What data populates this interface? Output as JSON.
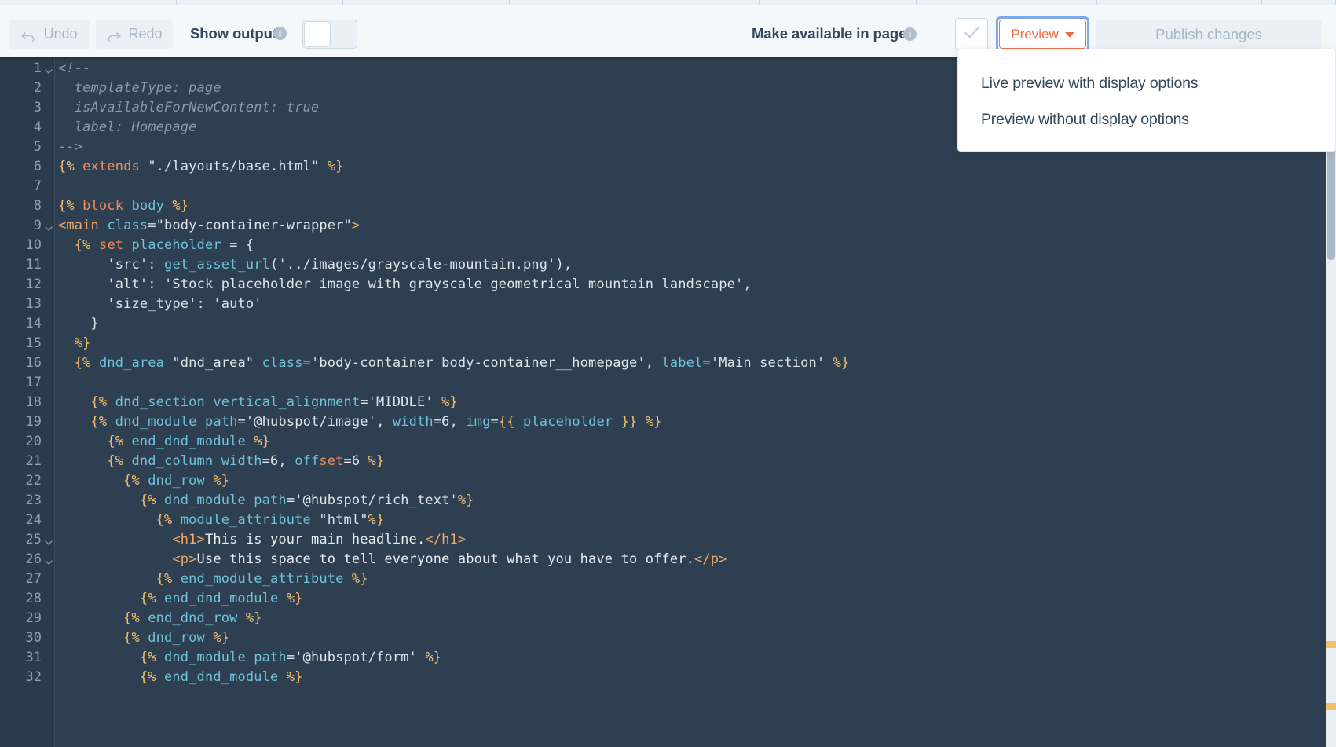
{
  "toolbar": {
    "undo_label": "Undo",
    "redo_label": "Redo",
    "show_output_label": "Show output",
    "show_output_toggle_state": "off",
    "make_available_label": "Make available in pages",
    "check_icon": "checkmark-icon",
    "preview_label": "Preview",
    "publish_label": "Publish changes",
    "info_glyph": "i"
  },
  "preview_menu": {
    "items": [
      {
        "label": "Live preview with display options"
      },
      {
        "label": "Preview without display options"
      }
    ]
  },
  "colors": {
    "editor_background": "#2e3f51",
    "gutter_background": "#2b3b4c",
    "toolbar_background": "#f5f8fa",
    "accent_orange": "#ef6c43",
    "focus_blue": "#7fa8e8",
    "delimiter_yellow": "#f4c06d",
    "keyword_orange": "#f08d5c",
    "function_teal": "#6fc3d9",
    "comment_gray": "#8c9aa8",
    "marker_yellow": "#f4c06d",
    "scrollbar_thumb": "#aab9c9"
  },
  "editor": {
    "language": "HubL / HTML",
    "first_visible_line": 1,
    "last_visible_line": 32,
    "fold_markers": [
      1,
      9,
      25,
      26
    ],
    "scrollbar_markers": [
      816,
      895
    ],
    "lines": [
      {
        "n": 1,
        "tokens": [
          {
            "t": "comment",
            "v": "<!--"
          }
        ]
      },
      {
        "n": 2,
        "tokens": [
          {
            "t": "comment",
            "v": "  templateType: page"
          }
        ]
      },
      {
        "n": 3,
        "tokens": [
          {
            "t": "comment",
            "v": "  isAvailableForNewContent: true"
          }
        ]
      },
      {
        "n": 4,
        "tokens": [
          {
            "t": "comment",
            "v": "  label: Homepage"
          }
        ]
      },
      {
        "n": 5,
        "tokens": [
          {
            "t": "comment",
            "v": "-->"
          }
        ]
      },
      {
        "n": 6,
        "tokens": [
          {
            "t": "delim",
            "v": "{% "
          },
          {
            "t": "kw",
            "v": "extends"
          },
          {
            "t": "str",
            "v": " \"./layouts/base.html\" "
          },
          {
            "t": "delim",
            "v": "%}"
          }
        ]
      },
      {
        "n": 7,
        "tokens": []
      },
      {
        "n": 8,
        "tokens": [
          {
            "t": "delim",
            "v": "{% "
          },
          {
            "t": "kw",
            "v": "block"
          },
          {
            "t": "fn",
            "v": " body "
          },
          {
            "t": "delim",
            "v": "%}"
          }
        ]
      },
      {
        "n": 9,
        "tokens": [
          {
            "t": "tag",
            "v": "<main"
          },
          {
            "t": "attr",
            "v": " class"
          },
          {
            "t": "punc",
            "v": "="
          },
          {
            "t": "str",
            "v": "\"body-container-wrapper\""
          },
          {
            "t": "tag",
            "v": ">"
          }
        ]
      },
      {
        "n": 10,
        "tokens": [
          {
            "t": "txt",
            "v": "  "
          },
          {
            "t": "delim",
            "v": "{% "
          },
          {
            "t": "kw",
            "v": "set"
          },
          {
            "t": "fn",
            "v": " placeholder "
          },
          {
            "t": "punc",
            "v": "= {"
          }
        ]
      },
      {
        "n": 11,
        "tokens": [
          {
            "t": "txt",
            "v": "      "
          },
          {
            "t": "str",
            "v": "'src'"
          },
          {
            "t": "punc",
            "v": ": "
          },
          {
            "t": "fn",
            "v": "get_asset_url"
          },
          {
            "t": "punc",
            "v": "("
          },
          {
            "t": "str",
            "v": "'../images/grayscale-mountain.png'"
          },
          {
            "t": "punc",
            "v": "),"
          }
        ]
      },
      {
        "n": 12,
        "tokens": [
          {
            "t": "txt",
            "v": "      "
          },
          {
            "t": "str",
            "v": "'alt'"
          },
          {
            "t": "punc",
            "v": ": "
          },
          {
            "t": "str",
            "v": "'Stock placeholder image with grayscale geometrical mountain landscape'"
          },
          {
            "t": "punc",
            "v": ","
          }
        ]
      },
      {
        "n": 13,
        "tokens": [
          {
            "t": "txt",
            "v": "      "
          },
          {
            "t": "str",
            "v": "'size_type'"
          },
          {
            "t": "punc",
            "v": ": "
          },
          {
            "t": "str",
            "v": "'auto'"
          }
        ]
      },
      {
        "n": 14,
        "tokens": [
          {
            "t": "txt",
            "v": "    "
          },
          {
            "t": "punc",
            "v": "}"
          }
        ]
      },
      {
        "n": 15,
        "tokens": [
          {
            "t": "txt",
            "v": "  "
          },
          {
            "t": "delim",
            "v": "%}"
          }
        ]
      },
      {
        "n": 16,
        "tokens": [
          {
            "t": "txt",
            "v": "  "
          },
          {
            "t": "delim",
            "v": "{% "
          },
          {
            "t": "fn",
            "v": "dnd_area"
          },
          {
            "t": "str",
            "v": " \"dnd_area\""
          },
          {
            "t": "attr",
            "v": " class"
          },
          {
            "t": "punc",
            "v": "="
          },
          {
            "t": "str",
            "v": "'body-container body-container__homepage'"
          },
          {
            "t": "punc",
            "v": ", "
          },
          {
            "t": "attr",
            "v": "label"
          },
          {
            "t": "punc",
            "v": "="
          },
          {
            "t": "str",
            "v": "'Main section' "
          },
          {
            "t": "delim",
            "v": "%}"
          }
        ]
      },
      {
        "n": 17,
        "tokens": []
      },
      {
        "n": 18,
        "tokens": [
          {
            "t": "txt",
            "v": "    "
          },
          {
            "t": "delim",
            "v": "{% "
          },
          {
            "t": "fn",
            "v": "dnd_section"
          },
          {
            "t": "attr",
            "v": " vertical_alignment"
          },
          {
            "t": "punc",
            "v": "="
          },
          {
            "t": "str",
            "v": "'MIDDLE' "
          },
          {
            "t": "delim",
            "v": "%}"
          }
        ]
      },
      {
        "n": 19,
        "tokens": [
          {
            "t": "txt",
            "v": "    "
          },
          {
            "t": "delim",
            "v": "{% "
          },
          {
            "t": "fn",
            "v": "dnd_module"
          },
          {
            "t": "attr",
            "v": " path"
          },
          {
            "t": "punc",
            "v": "="
          },
          {
            "t": "str",
            "v": "'@hubspot/image'"
          },
          {
            "t": "punc",
            "v": ", "
          },
          {
            "t": "attr",
            "v": "width"
          },
          {
            "t": "punc",
            "v": "=6, "
          },
          {
            "t": "attr",
            "v": "img"
          },
          {
            "t": "punc",
            "v": "="
          },
          {
            "t": "delim",
            "v": "{{"
          },
          {
            "t": "fn",
            "v": " placeholder "
          },
          {
            "t": "delim",
            "v": "}} %}"
          }
        ]
      },
      {
        "n": 20,
        "tokens": [
          {
            "t": "txt",
            "v": "      "
          },
          {
            "t": "delim",
            "v": "{% "
          },
          {
            "t": "fn",
            "v": "end_dnd_module"
          },
          {
            "t": "delim",
            "v": " %}"
          }
        ]
      },
      {
        "n": 21,
        "tokens": [
          {
            "t": "txt",
            "v": "      "
          },
          {
            "t": "delim",
            "v": "{% "
          },
          {
            "t": "fn",
            "v": "dnd_column"
          },
          {
            "t": "attr",
            "v": " width"
          },
          {
            "t": "punc",
            "v": "=6, "
          },
          {
            "t": "attr",
            "v": "off"
          },
          {
            "t": "kw",
            "v": "set"
          },
          {
            "t": "punc",
            "v": "=6 "
          },
          {
            "t": "delim",
            "v": "%}"
          }
        ]
      },
      {
        "n": 22,
        "tokens": [
          {
            "t": "txt",
            "v": "        "
          },
          {
            "t": "delim",
            "v": "{% "
          },
          {
            "t": "fn",
            "v": "dnd_row"
          },
          {
            "t": "delim",
            "v": " %}"
          }
        ]
      },
      {
        "n": 23,
        "tokens": [
          {
            "t": "txt",
            "v": "          "
          },
          {
            "t": "delim",
            "v": "{% "
          },
          {
            "t": "fn",
            "v": "dnd_module"
          },
          {
            "t": "attr",
            "v": " path"
          },
          {
            "t": "punc",
            "v": "="
          },
          {
            "t": "str",
            "v": "'@hubspot/rich_text'"
          },
          {
            "t": "delim",
            "v": "%}"
          }
        ]
      },
      {
        "n": 24,
        "tokens": [
          {
            "t": "txt",
            "v": "            "
          },
          {
            "t": "delim",
            "v": "{% "
          },
          {
            "t": "fn",
            "v": "module_attribute"
          },
          {
            "t": "str",
            "v": " \"html\""
          },
          {
            "t": "delim",
            "v": "%}"
          }
        ]
      },
      {
        "n": 25,
        "tokens": [
          {
            "t": "txt",
            "v": "              "
          },
          {
            "t": "tag",
            "v": "<h1>"
          },
          {
            "t": "txt",
            "v": "This is your main headline."
          },
          {
            "t": "tag",
            "v": "</h1>"
          }
        ]
      },
      {
        "n": 26,
        "tokens": [
          {
            "t": "txt",
            "v": "              "
          },
          {
            "t": "tag",
            "v": "<p>"
          },
          {
            "t": "txt",
            "v": "Use this space to tell everyone about what you have to offer."
          },
          {
            "t": "tag",
            "v": "</p>"
          }
        ]
      },
      {
        "n": 27,
        "tokens": [
          {
            "t": "txt",
            "v": "            "
          },
          {
            "t": "delim",
            "v": "{% "
          },
          {
            "t": "fn",
            "v": "end_module_attribute"
          },
          {
            "t": "delim",
            "v": " %}"
          }
        ]
      },
      {
        "n": 28,
        "tokens": [
          {
            "t": "txt",
            "v": "          "
          },
          {
            "t": "delim",
            "v": "{% "
          },
          {
            "t": "fn",
            "v": "end_dnd_module"
          },
          {
            "t": "delim",
            "v": " %}"
          }
        ]
      },
      {
        "n": 29,
        "tokens": [
          {
            "t": "txt",
            "v": "        "
          },
          {
            "t": "delim",
            "v": "{% "
          },
          {
            "t": "fn",
            "v": "end_dnd_row"
          },
          {
            "t": "delim",
            "v": " %}"
          }
        ]
      },
      {
        "n": 30,
        "tokens": [
          {
            "t": "txt",
            "v": "        "
          },
          {
            "t": "delim",
            "v": "{% "
          },
          {
            "t": "fn",
            "v": "dnd_row"
          },
          {
            "t": "delim",
            "v": " %}"
          }
        ]
      },
      {
        "n": 31,
        "tokens": [
          {
            "t": "txt",
            "v": "          "
          },
          {
            "t": "delim",
            "v": "{% "
          },
          {
            "t": "fn",
            "v": "dnd_module"
          },
          {
            "t": "attr",
            "v": " path"
          },
          {
            "t": "punc",
            "v": "="
          },
          {
            "t": "str",
            "v": "'@hubspot/form' "
          },
          {
            "t": "delim",
            "v": "%}"
          }
        ]
      },
      {
        "n": 32,
        "tokens": [
          {
            "t": "txt",
            "v": "          "
          },
          {
            "t": "delim",
            "v": "{% "
          },
          {
            "t": "fn",
            "v": "end_dnd_module"
          },
          {
            "t": "delim",
            "v": " %}"
          }
        ]
      }
    ]
  }
}
